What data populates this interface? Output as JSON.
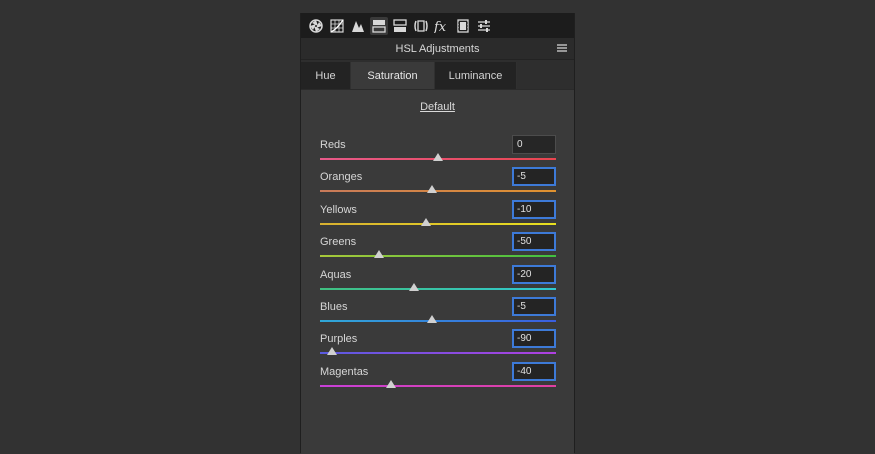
{
  "panel": {
    "title": "HSL Adjustments",
    "toolbar_icons": [
      "aperture-icon",
      "tone-curve-icon",
      "detail-icon",
      "hsl-grayscale-icon",
      "split-toning-icon",
      "lens-corrections-icon",
      "effects-fx-icon",
      "camera-calibration-icon",
      "presets-sliders-icon"
    ],
    "active_icon": "hsl-grayscale-icon",
    "menu_icon": "panel-menu-icon"
  },
  "tabs": [
    {
      "label": "Hue",
      "active": false
    },
    {
      "label": "Saturation",
      "active": true
    },
    {
      "label": "Luminance",
      "active": false
    }
  ],
  "default_label": "Default",
  "colors": {
    "accent": "#3d7ad8",
    "background": "#323232"
  },
  "sliders": [
    {
      "label": "Reds",
      "value": "0",
      "amount": 0,
      "focused": false,
      "gradient": [
        "#e85a8a",
        "#e8454f"
      ]
    },
    {
      "label": "Oranges",
      "value": "-5",
      "amount": -5,
      "focused": true,
      "gradient": [
        "#c87a5a",
        "#e0922f"
      ]
    },
    {
      "label": "Yellows",
      "value": "-10",
      "amount": -10,
      "focused": true,
      "gradient": [
        "#d8b030",
        "#e8e020"
      ]
    },
    {
      "label": "Greens",
      "value": "-50",
      "amount": -50,
      "focused": true,
      "gradient": [
        "#a8c83a",
        "#40c040"
      ]
    },
    {
      "label": "Aquas",
      "value": "-20",
      "amount": -20,
      "focused": true,
      "gradient": [
        "#40c080",
        "#30c8d0"
      ]
    },
    {
      "label": "Blues",
      "value": "-5",
      "amount": -5,
      "focused": true,
      "gradient": [
        "#30a8d8",
        "#3a5ee0"
      ]
    },
    {
      "label": "Purples",
      "value": "-90",
      "amount": -90,
      "focused": true,
      "gradient": [
        "#5a5ae0",
        "#b040e0"
      ]
    },
    {
      "label": "Magentas",
      "value": "-40",
      "amount": -40,
      "focused": true,
      "gradient": [
        "#c840d8",
        "#e040a0"
      ]
    }
  ]
}
